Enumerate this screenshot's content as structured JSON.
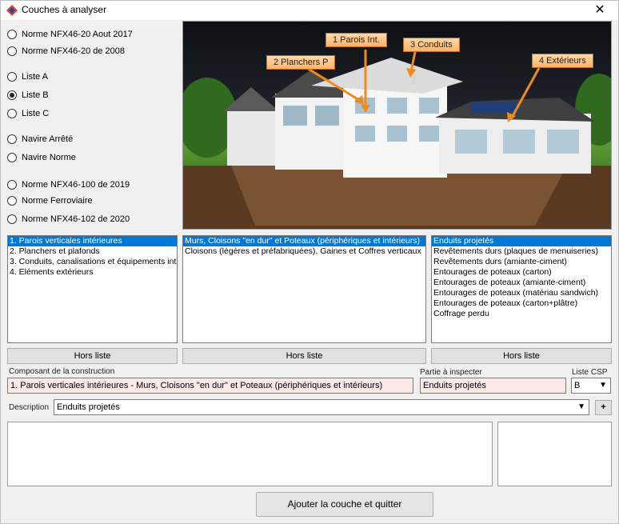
{
  "window": {
    "title": "Couches à analyser",
    "close_glyph": "✕"
  },
  "radios": [
    {
      "label": "Norme NFX46-20 Aout 2017",
      "checked": false
    },
    {
      "label": "Norme NFX46-20 de 2008",
      "checked": false
    },
    {
      "label": "Liste A",
      "checked": false
    },
    {
      "label": "Liste B",
      "checked": true
    },
    {
      "label": "Liste C",
      "checked": false
    },
    {
      "label": "Navire Arrêté",
      "checked": false
    },
    {
      "label": "Navire Norme",
      "checked": false
    },
    {
      "label": "Norme NFX46-100 de 2019",
      "checked": false
    },
    {
      "label": "Norme Ferroviaire",
      "checked": false
    },
    {
      "label": "Norme NFX46-102 de 2020",
      "checked": false
    }
  ],
  "callouts": {
    "c1": "1 Parois Int.",
    "c2": "2 Planchers P",
    "c3": "3 Conduits",
    "c4": "4 Extérieurs"
  },
  "list1": [
    "1. Parois verticales intérieures",
    "2. Planchers et plafonds",
    "3. Conduits, canalisations et équipements int",
    "4. Eléments extérieurs"
  ],
  "list2": [
    "Murs, Cloisons \"en dur\" et Poteaux (périphériques et intérieurs)",
    "Cloisons (légères et préfabriquées), Gaines et Coffres verticaux"
  ],
  "list3": [
    "Enduits projetés",
    "Revêtements durs (plaques de menuiseries)",
    "Revêtements durs (amiante-ciment)",
    "Entourages de poteaux (carton)",
    "Entourages de poteaux (amiante-ciment)",
    "Entourages de poteaux (matériau sandwich)",
    "Entourages de poteaux (carton+plâtre)",
    "Coffrage perdu"
  ],
  "buttons": {
    "hors1": "Hors liste",
    "hors2": "Hors liste",
    "hors3": "Hors liste",
    "plus": "+",
    "submit": "Ajouter la couche et quitter"
  },
  "form": {
    "composant_label": "Composant de la construction",
    "composant_value": "1. Parois verticales intérieures - Murs, Cloisons \"en dur\" et Poteaux (périphériques et intérieurs)",
    "partie_label": "Partie à inspecter",
    "partie_value": "Enduits projetés",
    "csp_label": "Liste CSP",
    "csp_value": "B",
    "description_label": "Description",
    "description_value": "Enduits projetés"
  },
  "colors": {
    "selection": "#0078d7",
    "field_bg": "#fde8e8",
    "callout": "#ffb366",
    "arrow": "#f08a1c"
  }
}
